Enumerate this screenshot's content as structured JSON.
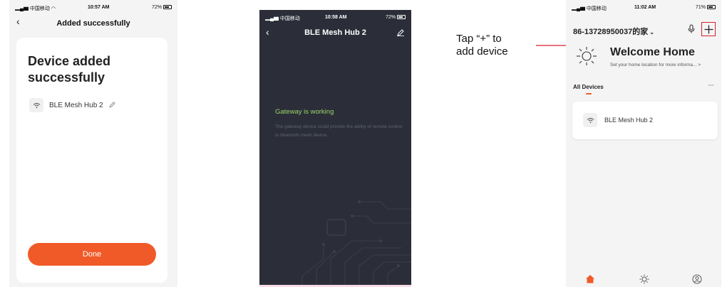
{
  "screen1": {
    "status": {
      "carrier": "中国移动",
      "time": "10:57 AM",
      "battery": "72%"
    },
    "nav": {
      "back_glyph": "‹",
      "title": "Added successfully"
    },
    "headline": "Device added successfully",
    "device": {
      "name": "BLE Mesh Hub 2",
      "icon": "wifi-icon"
    },
    "done_label": "Done",
    "accent": "#f05a28"
  },
  "screen2": {
    "status": {
      "carrier": "中国移动",
      "time": "10:58 AM",
      "battery": "72%"
    },
    "nav": {
      "back_glyph": "‹",
      "title": "BLE Mesh Hub 2"
    },
    "gateway_title": "Gateway is working",
    "gateway_desc": "The gateway device  could  provide the ability of remote control to bluetooth mesh device.",
    "background": "#2b2e38",
    "status_color": "#9ed36a"
  },
  "annotation": {
    "line1": "Tap “+” to",
    "line2": "add device",
    "line_color": "#d71d2a"
  },
  "screen3": {
    "status": {
      "carrier": "中国移动",
      "time": "11:02 AM",
      "battery": "71%"
    },
    "home_name": "86-13728950037的家",
    "welcome_title": "Welcome Home",
    "welcome_sub": "Set your home location for more informa...  >",
    "tab_label": "All Devices",
    "more_glyph": "···",
    "device": {
      "name": "BLE Mesh Hub 2",
      "icon": "wifi-icon"
    },
    "tabbar": [
      "home-icon",
      "smart-scene-icon",
      "profile-icon"
    ]
  }
}
